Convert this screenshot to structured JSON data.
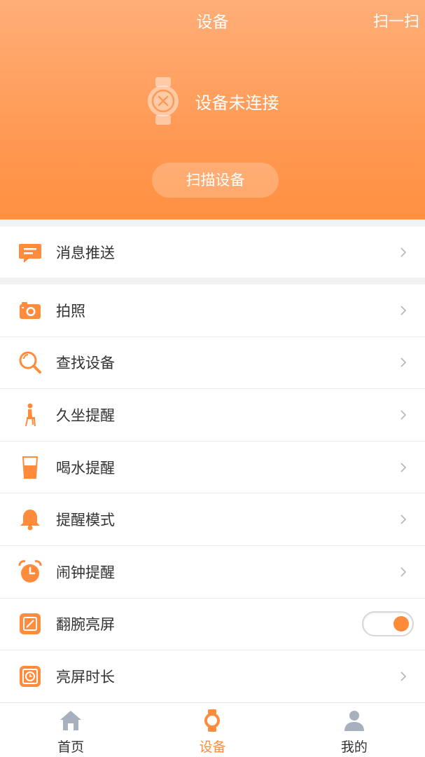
{
  "header": {
    "title": "设备",
    "scan_link": "扫一扫",
    "status_text": "设备未连接",
    "scan_button": "扫描设备"
  },
  "colors": {
    "accent": "#ff8c3c",
    "header_gradient_top": "#ffae78",
    "header_gradient_bottom": "#ff9040"
  },
  "sections": {
    "first": [
      {
        "label": "消息推送",
        "icon": "message-icon"
      }
    ],
    "second": [
      {
        "label": "拍照",
        "icon": "camera-icon"
      },
      {
        "label": "查找设备",
        "icon": "search-icon"
      },
      {
        "label": "久坐提醒",
        "icon": "sedentary-icon"
      },
      {
        "label": "喝水提醒",
        "icon": "water-glass-icon"
      },
      {
        "label": "提醒模式",
        "icon": "bell-icon"
      },
      {
        "label": "闹钟提醒",
        "icon": "alarm-clock-icon"
      },
      {
        "label": "翻腕亮屏",
        "icon": "wrist-screen-icon",
        "toggle": true
      },
      {
        "label": "亮屏时长",
        "icon": "screen-duration-icon"
      }
    ]
  },
  "tabs": [
    {
      "label": "首页",
      "icon": "home-icon",
      "active": false
    },
    {
      "label": "设备",
      "icon": "watch-icon",
      "active": true
    },
    {
      "label": "我的",
      "icon": "user-icon",
      "active": false
    }
  ]
}
